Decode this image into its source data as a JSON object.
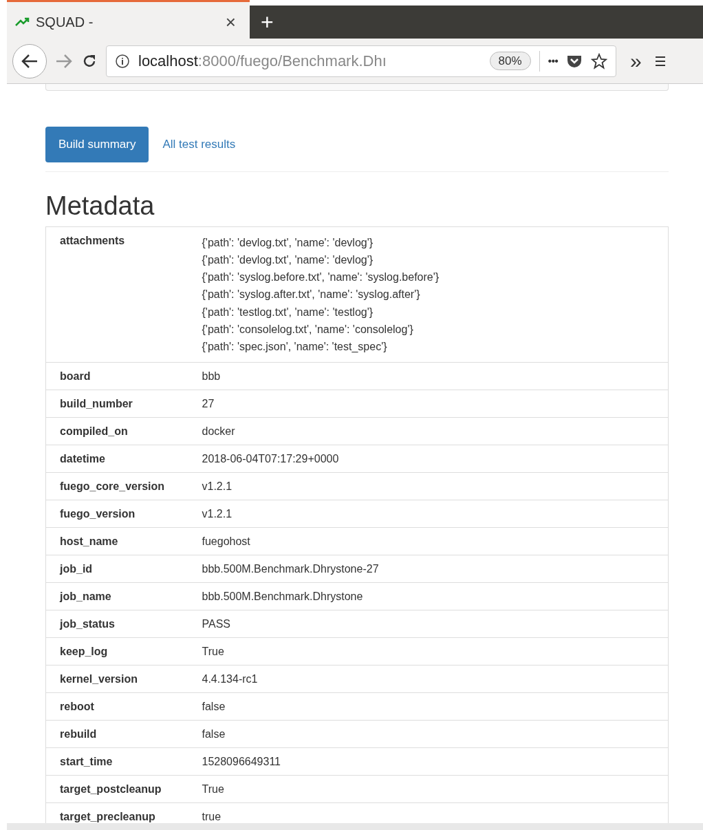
{
  "browser": {
    "tab_title": "SQUAD -",
    "close": "×",
    "new_tab": "+",
    "url_host": "localhost",
    "url_rest": ":8000/fuego/Benchmark.Dhı",
    "zoom": "80%",
    "more": "•••",
    "overflow": "»"
  },
  "nav_tabs": [
    {
      "label": "Build summary",
      "selected": true
    },
    {
      "label": "All test results",
      "selected": false
    }
  ],
  "heading": "Metadata",
  "metadata": [
    {
      "key": "attachments",
      "values": [
        "{'path': 'devlog.txt', 'name': 'devlog'}",
        "{'path': 'devlog.txt', 'name': 'devlog'}",
        "{'path': 'syslog.before.txt', 'name': 'syslog.before'}",
        "{'path': 'syslog.after.txt', 'name': 'syslog.after'}",
        "{'path': 'testlog.txt', 'name': 'testlog'}",
        "{'path': 'consolelog.txt', 'name': 'consolelog'}",
        "{'path': 'spec.json', 'name': 'test_spec'}"
      ]
    },
    {
      "key": "board",
      "values": [
        "bbb"
      ]
    },
    {
      "key": "build_number",
      "values": [
        "27"
      ]
    },
    {
      "key": "compiled_on",
      "values": [
        "docker"
      ]
    },
    {
      "key": "datetime",
      "values": [
        "2018-06-04T07:17:29+0000"
      ]
    },
    {
      "key": "fuego_core_version",
      "values": [
        "v1.2.1"
      ]
    },
    {
      "key": "fuego_version",
      "values": [
        "v1.2.1"
      ]
    },
    {
      "key": "host_name",
      "values": [
        "fuegohost"
      ]
    },
    {
      "key": "job_id",
      "values": [
        "bbb.500M.Benchmark.Dhrystone-27"
      ]
    },
    {
      "key": "job_name",
      "values": [
        "bbb.500M.Benchmark.Dhrystone"
      ]
    },
    {
      "key": "job_status",
      "values": [
        "PASS"
      ]
    },
    {
      "key": "keep_log",
      "values": [
        "True"
      ]
    },
    {
      "key": "kernel_version",
      "values": [
        "4.4.134-rc1"
      ]
    },
    {
      "key": "reboot",
      "values": [
        "false"
      ]
    },
    {
      "key": "rebuild",
      "values": [
        "false"
      ]
    },
    {
      "key": "start_time",
      "values": [
        "1528096649311"
      ]
    },
    {
      "key": "target_postcleanup",
      "values": [
        "True"
      ]
    },
    {
      "key": "target_precleanup",
      "values": [
        "true"
      ]
    }
  ]
}
